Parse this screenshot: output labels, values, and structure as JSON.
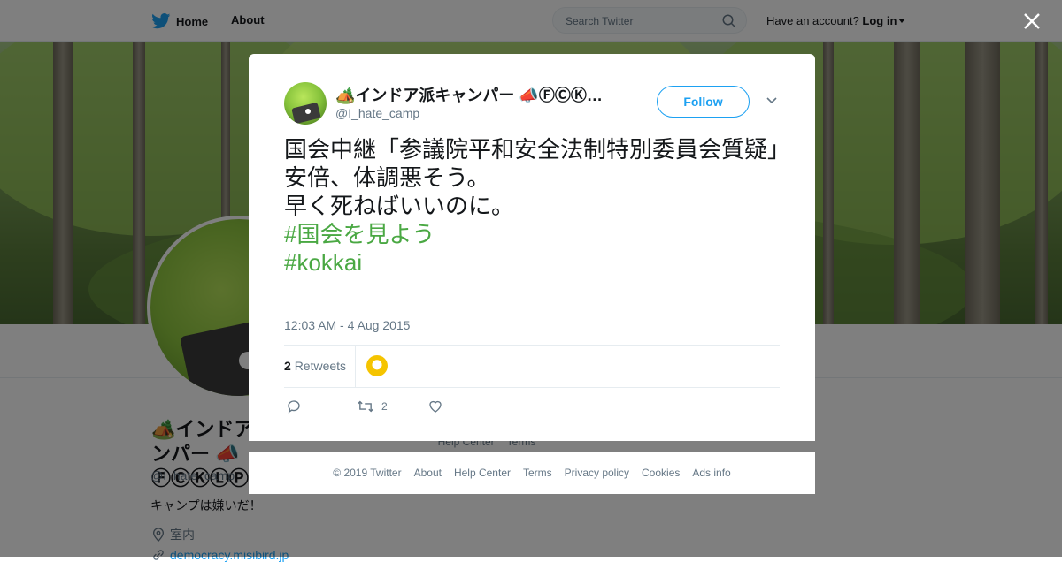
{
  "nav": {
    "home": "Home",
    "about": "About",
    "search_placeholder": "Search Twitter",
    "have_account": "Have an account?",
    "login": "Log in"
  },
  "profile": {
    "name": "🏕️インドア派キャンパー 📣ⒻⒸⓀⓁⓅⒹ🔥",
    "handle": "@I_hate_camp",
    "bio": "キャンプは嫌いだ！",
    "location": "室内",
    "url": "democracy.misibird.jp",
    "mini_footer": [
      "Help Center",
      "Terms"
    ]
  },
  "tweet": {
    "author_name": "🏕️インドア派キャンパー 📣ⒻⒸⓀⓁⓅⒹ🔥",
    "author_handle": "@I_hate_camp",
    "follow_label": "Follow",
    "text_lines": [
      "国会中継「参議院平和安全法制特別委員会質疑」",
      "安倍、体調悪そう。",
      "早く死ねばいいのに。"
    ],
    "hashtags": [
      "#国会を見よう",
      "#kokkai"
    ],
    "timestamp": "12:03 AM - 4 Aug 2015",
    "retweets_count": "2",
    "retweets_label": "Retweets",
    "retweet_action_count": "2"
  },
  "footer": {
    "copyright": "© 2019 Twitter",
    "links": [
      "About",
      "Help Center",
      "Terms",
      "Privacy policy",
      "Cookies",
      "Ads info"
    ]
  },
  "colors": {
    "brand": "#1da1f2",
    "hashtag": "#4aa843",
    "text": "#14171a",
    "muted": "#657786"
  },
  "icons": [
    "twitter-bird-icon",
    "search-icon",
    "close-icon",
    "chevron-down-icon",
    "reply-icon",
    "retweet-icon",
    "like-icon",
    "location-icon",
    "link-icon"
  ]
}
